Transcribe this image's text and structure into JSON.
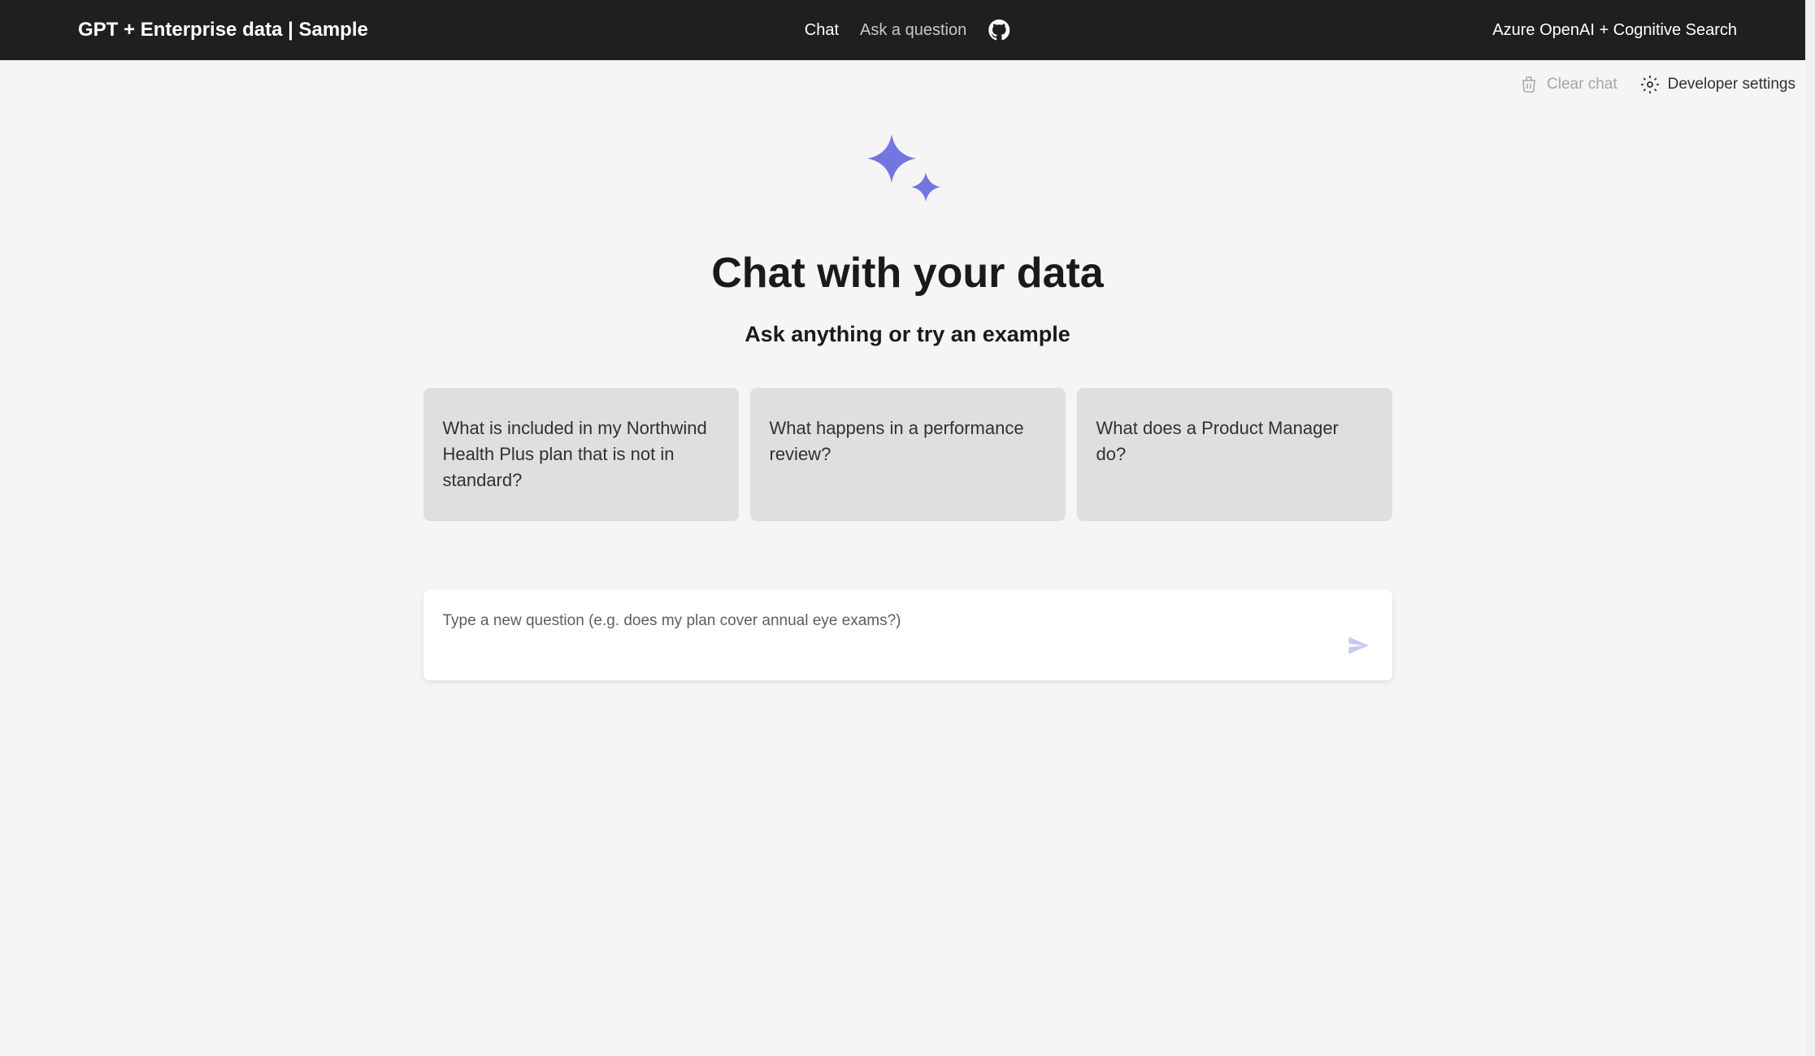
{
  "header": {
    "title": "GPT + Enterprise data | Sample",
    "nav": {
      "chat": "Chat",
      "ask": "Ask a question"
    },
    "tagline": "Azure OpenAI + Cognitive Search"
  },
  "toolbar": {
    "clear_label": "Clear chat",
    "dev_settings_label": "Developer settings"
  },
  "main": {
    "title": "Chat with your data",
    "subtitle": "Ask anything or try an example",
    "examples": [
      "What is included in my Northwind Health Plus plan that is not in standard?",
      "What happens in a performance review?",
      "What does a Product Manager do?"
    ],
    "input_placeholder": "Type a new question (e.g. does my plan cover annual eye exams?)"
  },
  "colors": {
    "accent": "#7376e1",
    "send_disabled": "#c7c9f0"
  }
}
